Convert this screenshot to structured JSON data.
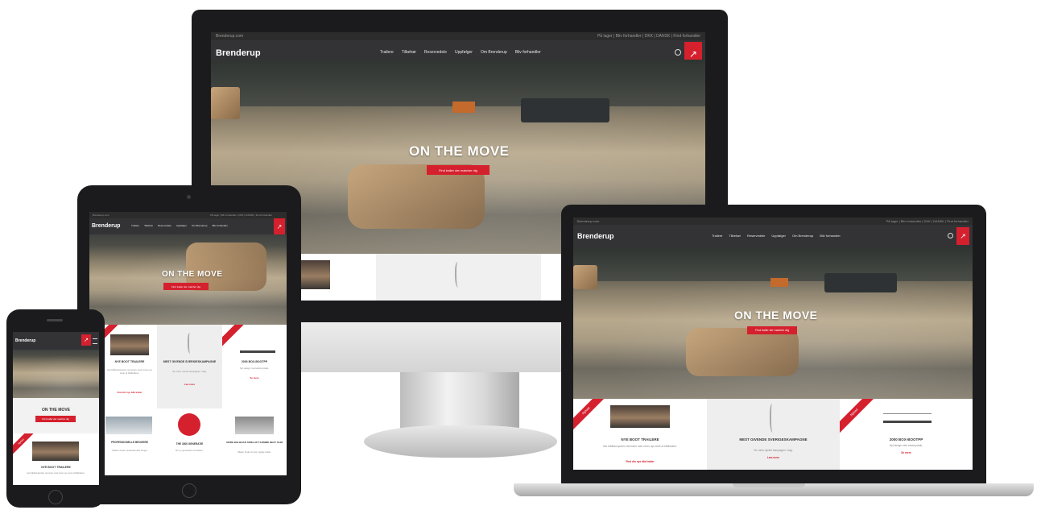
{
  "site": {
    "brand": "Brenderup",
    "topbar_left": "Brenderup.com",
    "topbar_right": "På lager | Bliv forhandler | DKK | DANSK | Find forhandler",
    "nav": [
      "Trailere",
      "Tilbehør",
      "Reservedele",
      "Uppfølger",
      "Om Brenderup",
      "Bliv forhandler"
    ],
    "cart_icon": "cart-icon",
    "search_icon": "search-icon"
  },
  "hero": {
    "title": "ON THE MOVE",
    "cta": "Find trailer der matcher dig"
  },
  "tiles": [
    {
      "ribbon": "Nyhed",
      "title": "NYE BOOT TRAILERE",
      "text": "Gør bådtransporten nemmere med vores nye serie af bådtrailere.",
      "link": "Find din nye båd trailer"
    },
    {
      "ribbon": "",
      "title": "MEST GIVENDE SVERIGESKAMPAGNE",
      "text": "Se vores nyeste kampagner i dag.",
      "link": "Læs mere"
    },
    {
      "ribbon": "Nyhed",
      "title": "2000 BOX-BOOTPP",
      "text": "Nyt design med ekstra plads.",
      "link": "Se mere"
    },
    {
      "ribbon": "",
      "title": "PROFESSIONELLE BRUGERE",
      "text": "Trailere til den professionelle bruger.",
      "link": "Læs mere"
    },
    {
      "ribbon": "",
      "title": "THE 3000 GENERATIE",
      "text": "En ny generation af trailere.",
      "link": "Læs mere"
    },
    {
      "ribbon": "",
      "title": "SPIRE BIG-BOAD SPIELLIFT KOMME NEXT SLIM",
      "text": "Sådan finder du den rigtige trailer.",
      "link": "Læs mere"
    }
  ],
  "colors": {
    "accent": "#d5202e",
    "nav_bg": "#333336",
    "bezel": "#1b1b1d"
  }
}
